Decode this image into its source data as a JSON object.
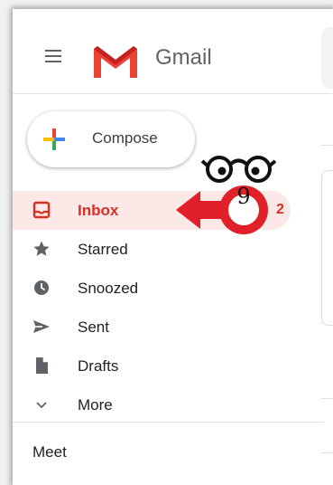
{
  "header": {
    "brand": "Gmail",
    "menu_icon": "hamburger-menu-icon",
    "logo_icon": "gmail-m-logo-icon"
  },
  "compose": {
    "label": "Compose",
    "icon": "plus-icon"
  },
  "nav": {
    "items": [
      {
        "label": "Inbox",
        "icon": "inbox-icon",
        "count": "2",
        "active": true
      },
      {
        "label": "Starred",
        "icon": "star-icon"
      },
      {
        "label": "Snoozed",
        "icon": "clock-icon"
      },
      {
        "label": "Sent",
        "icon": "send-icon"
      },
      {
        "label": "Drafts",
        "icon": "draft-icon"
      },
      {
        "label": "More",
        "icon": "chevron-down-icon"
      }
    ]
  },
  "meet": {
    "label": "Meet"
  },
  "annotation": {
    "number": "9",
    "icon": "glasses-icon",
    "arrow_icon": "arrow-left-icon"
  },
  "colors": {
    "accent": "#d93025",
    "active_bg": "#fce8e6",
    "icon_gray": "#5f6368"
  }
}
